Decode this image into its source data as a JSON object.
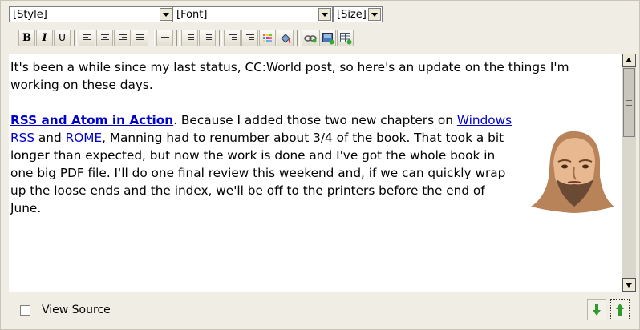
{
  "toolbar": {
    "style_select": {
      "value": "[Style]"
    },
    "font_select": {
      "value": "[Font]"
    },
    "size_select": {
      "value": "[Size]"
    },
    "buttons": {
      "bold": "B",
      "italic": "I",
      "underline": "U"
    }
  },
  "content": {
    "paragraph1": "It's been a while since my last status, CC:World post, so here's an update on the things I'm working on these days.",
    "paragraph2": {
      "link_book": "RSS and Atom in Action",
      "text_a": ". Because I added those two new chapters on ",
      "link_windows_rss": "Windows RSS",
      "text_b": " and ",
      "link_rome": "ROME",
      "text_c": ", Manning had to renumber about 3/4 of the book. That took a bit longer than expected, but now the work is done and I've got the whole book in one big PDF file. I'll do one final review this weekend and, if we can quickly wrap up the loose ends and the index, we'll be off to the printers before the end of June."
    }
  },
  "footer": {
    "view_source_label": "View Source",
    "view_source_checked": false
  },
  "icons": {
    "move_down": "arrow-down-icon",
    "move_up": "arrow-up-icon"
  },
  "colors": {
    "panel_bg": "#f0ede4",
    "link": "#0000cc",
    "arrow_green": "#2f9a2f"
  }
}
